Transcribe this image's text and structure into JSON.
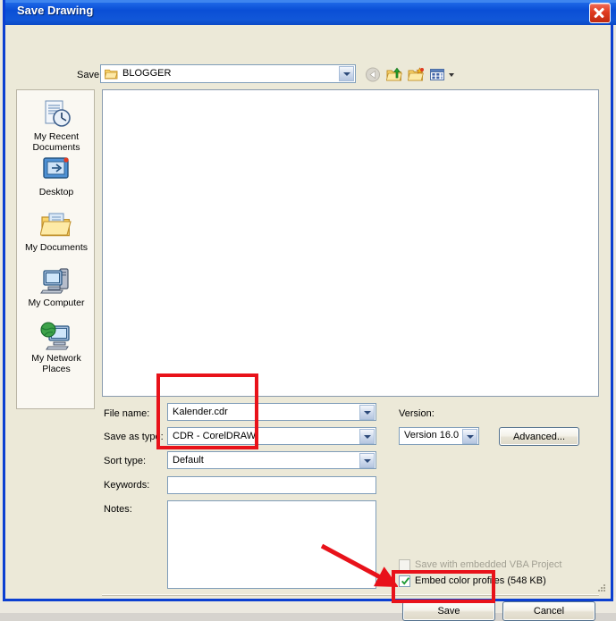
{
  "window": {
    "title": "Save Drawing",
    "close_icon": "close-icon"
  },
  "toolbar": {
    "save_in_label": "Save in:",
    "save_in_value": "BLOGGER",
    "save_in_icon": "folder-icon",
    "buttons": [
      {
        "name": "back-button",
        "icon": "back-arrow-icon",
        "disabled": true
      },
      {
        "name": "up-one-level-button",
        "icon": "up-folder-icon",
        "disabled": false
      },
      {
        "name": "create-new-folder-button",
        "icon": "new-folder-icon",
        "disabled": false
      },
      {
        "name": "views-button",
        "icon": "views-grid-icon",
        "disabled": false
      }
    ]
  },
  "places": [
    {
      "label_line1": "My Recent",
      "label_line2": "Documents",
      "icon": "recent-documents-icon"
    },
    {
      "label_line1": "Desktop",
      "label_line2": "",
      "icon": "desktop-icon"
    },
    {
      "label_line1": "My Documents",
      "label_line2": "",
      "icon": "my-documents-icon"
    },
    {
      "label_line1": "My Computer",
      "label_line2": "",
      "icon": "my-computer-icon"
    },
    {
      "label_line1": "My Network",
      "label_line2": "Places",
      "icon": "network-places-icon"
    }
  ],
  "form": {
    "file_name_label": "File name:",
    "file_name_value": "Kalender.cdr",
    "save_as_type_label": "Save as type:",
    "save_as_type_value": "CDR - CorelDRAW",
    "sort_type_label": "Sort type:",
    "sort_type_value": "Default",
    "keywords_label": "Keywords:",
    "keywords_value": "",
    "keywords_placeholder": "",
    "notes_label": "Notes:",
    "notes_value": "",
    "notes_placeholder": "",
    "version_label": "Version:",
    "version_value": "Version 16.0",
    "advanced_label": "Advanced..."
  },
  "options": {
    "vba_label": "Save with embedded VBA Project",
    "vba_checked": false,
    "vba_enabled": false,
    "embed_label": "Embed color profiles (548 KB)",
    "embed_checked": true,
    "embed_enabled": true
  },
  "buttons": {
    "save_label": "Save",
    "cancel_label": "Cancel"
  },
  "annotations": {
    "fields_highlight": "red-rectangle-around-file-fields",
    "save_highlight": "red-rectangle-around-save-button",
    "arrow": "red-arrow-pointing-to-save-button",
    "color": "#e8121a"
  },
  "colors": {
    "title_bar": "#0b4fd6",
    "dialog_face": "#ece9d8",
    "field_border": "#7f9db9",
    "accent_red": "#e8121a",
    "check_green": "#1f9b34"
  }
}
